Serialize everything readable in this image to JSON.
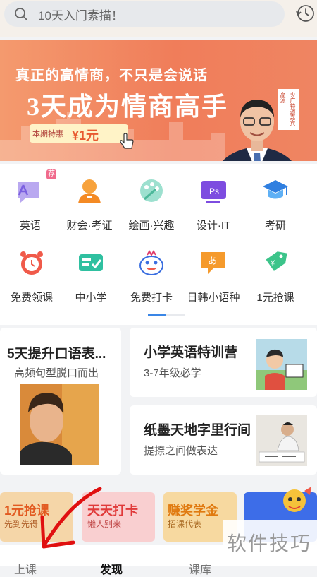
{
  "search": {
    "placeholder": "10天入门素描！"
  },
  "banner": {
    "tagline": "真正的高情商，不只是会说话",
    "title": "3天成为情商高手",
    "pill_label": "本期特惠",
    "pill_price": "¥1元",
    "badge_line1": "高源",
    "badge_line2": "央广特邀嘉宾",
    "slide_count": 5,
    "active_slide": 1
  },
  "categories": [
    {
      "label": "英语",
      "icon": "english-icon",
      "badge": "荐"
    },
    {
      "label": "财会·考证",
      "icon": "accounting-icon"
    },
    {
      "label": "绘画·兴趣",
      "icon": "palette-icon"
    },
    {
      "label": "设计·IT",
      "icon": "design-icon"
    },
    {
      "label": "考研",
      "icon": "graduation-cap-icon"
    },
    {
      "label": "免费领课",
      "icon": "alarm-clock-icon"
    },
    {
      "label": "中小学",
      "icon": "checklist-icon"
    },
    {
      "label": "免费打卡",
      "icon": "mascot-icon"
    },
    {
      "label": "日韩小语种",
      "icon": "speech-bubble-icon"
    },
    {
      "label": "1元抢课",
      "icon": "price-tag-icon"
    }
  ],
  "cards": {
    "big": {
      "title": "5天提升口语表...",
      "subtitle": "高频句型脱口而出"
    },
    "top": {
      "title": "小学英语特训营",
      "subtitle": "3-7年级必学"
    },
    "bottom": {
      "title": "纸墨天地字里行间",
      "subtitle": "提捺之间做表达"
    }
  },
  "promos": [
    {
      "title": "1元抢课",
      "subtitle": "先到先得",
      "color": "#f5d6a8"
    },
    {
      "title": "天天打卡",
      "subtitle": "懒人别来",
      "color": "#f9cfd0"
    },
    {
      "title": "赚奖学金",
      "subtitle": "招课代表",
      "color": "#f7d9a0"
    }
  ],
  "tabs": [
    "上课",
    "发现",
    "课库"
  ],
  "watermark": "软件技巧",
  "colors": {
    "accent": "#3a86e6",
    "banner": "#f07d5a",
    "arrow": "#e01010"
  }
}
